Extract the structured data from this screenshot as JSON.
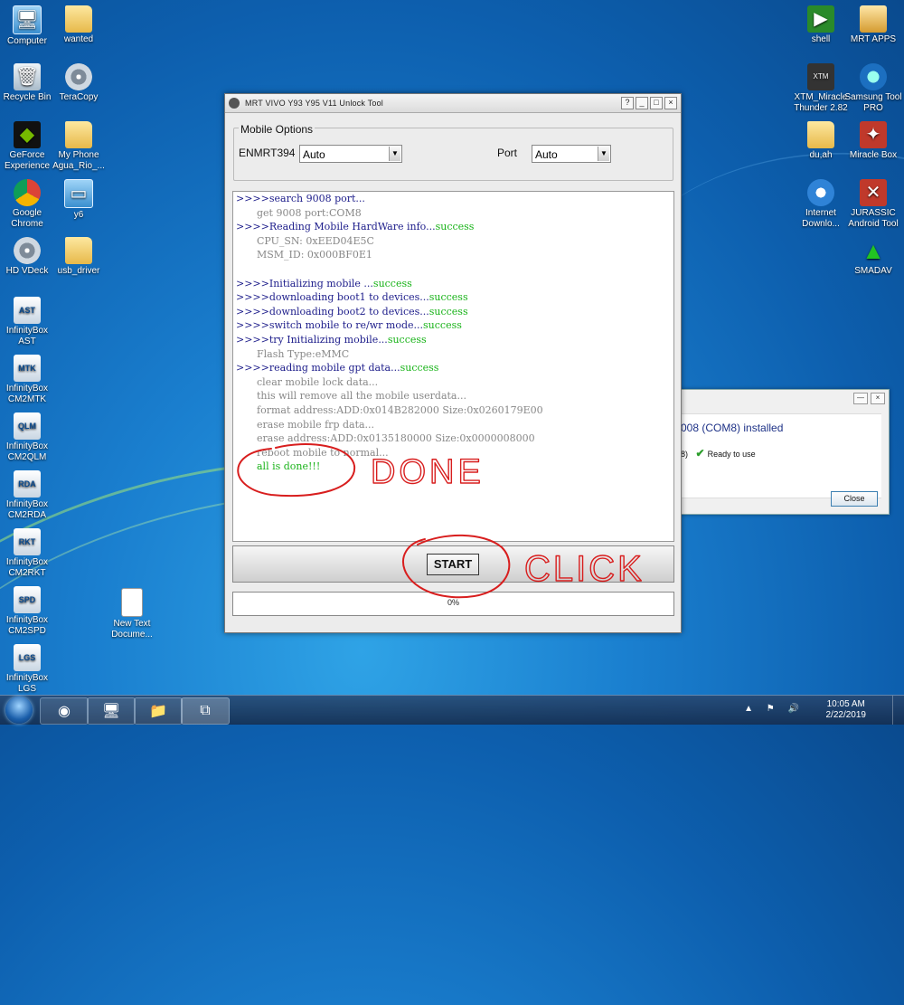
{
  "desktop": {
    "icons_left": [
      {
        "label": "Computer",
        "icon": "computer-icon"
      },
      {
        "label": "wanted",
        "icon": "folder-icon"
      },
      {
        "label": "Recycle Bin",
        "icon": "recycle-bin-icon"
      },
      {
        "label": "TeraCopy",
        "icon": "teracopy-icon"
      },
      {
        "label": "GeForce Experience",
        "icon": "geforce-icon"
      },
      {
        "label": "My Phone Agua_Rio_...",
        "icon": "folder-icon"
      },
      {
        "label": "Google Chrome",
        "icon": "chrome-icon"
      },
      {
        "label": "y6",
        "icon": "window-icon"
      },
      {
        "label": "HD VDeck",
        "icon": "disc-icon"
      },
      {
        "label": "usb_driver",
        "icon": "folder-icon"
      },
      {
        "label": "InfinityBox AST",
        "badge": "AST",
        "icon": "infinitybox-icon"
      },
      {
        "label": "InfinityBox CM2MTK",
        "badge": "MTK",
        "icon": "infinitybox-icon"
      },
      {
        "label": "InfinityBox CM2QLM",
        "badge": "QLM",
        "icon": "infinitybox-icon"
      },
      {
        "label": "InfinityBox CM2RDA",
        "badge": "RDA",
        "icon": "infinitybox-icon"
      },
      {
        "label": "InfinityBox CM2RKT",
        "badge": "RKT",
        "icon": "infinitybox-icon"
      },
      {
        "label": "InfinityBox CM2SPD",
        "badge": "SPD",
        "icon": "infinitybox-icon"
      },
      {
        "label": "InfinityBox LGS",
        "badge": "LGS",
        "icon": "infinitybox-icon"
      },
      {
        "label": "New Text Docume...",
        "icon": "text-document-icon"
      }
    ],
    "icons_right": [
      {
        "label": "shell",
        "icon": "shell-icon"
      },
      {
        "label": "MRT APPS",
        "icon": "mrt-apps-icon"
      },
      {
        "label": "XTM_Miracle Thunder 2.82",
        "icon": "xtm-icon"
      },
      {
        "label": "Samsung Tool PRO",
        "icon": "samsung-tool-icon"
      },
      {
        "label": "du,ah",
        "icon": "folder-icon"
      },
      {
        "label": "Miracle Box",
        "icon": "miracle-box-icon"
      },
      {
        "label": "Internet Downlo...",
        "icon": "internet-download-icon"
      },
      {
        "label": "JURASSIC Android Tool",
        "icon": "jurassic-icon"
      },
      {
        "label": "SMADAV",
        "icon": "smadav-icon"
      }
    ]
  },
  "window": {
    "title": "MRT VIVO Y93 Y95 V11 Unlock Tool",
    "buttons": {
      "help": "?",
      "minimize": "_",
      "maximize": "□",
      "close": "×"
    },
    "mobile_options": {
      "legend": "Mobile Options",
      "model_label": "ENMRT394",
      "model_value": "Auto",
      "port_label": "Port",
      "port_value": "Auto"
    },
    "log": [
      {
        "style": "blue",
        "text": ">>>>search 9008 port...",
        "status": ""
      },
      {
        "style": "gray",
        "text": "get 9008 port:COM8",
        "status": ""
      },
      {
        "style": "blue",
        "text": ">>>>Reading Mobile HardWare info...",
        "status": "success"
      },
      {
        "style": "gray",
        "text": "CPU_SN:  0xEED04E5C",
        "status": ""
      },
      {
        "style": "gray",
        "text": "MSM_ID:  0x000BF0E1",
        "status": ""
      },
      {
        "style": "blank",
        "text": "",
        "status": ""
      },
      {
        "style": "blue",
        "text": ">>>>Initializing mobile ...",
        "status": "success"
      },
      {
        "style": "blue",
        "text": ">>>>downloading boot1 to devices...",
        "status": "success"
      },
      {
        "style": "blue",
        "text": ">>>>downloading boot2 to devices...",
        "status": "success"
      },
      {
        "style": "blue",
        "text": ">>>>switch mobile to re/wr mode...",
        "status": "success"
      },
      {
        "style": "blue",
        "text": ">>>>try Initializing mobile...",
        "status": "success"
      },
      {
        "style": "gray",
        "text": "Flash Type:eMMC",
        "status": ""
      },
      {
        "style": "blue",
        "text": ">>>>reading mobile gpt data...",
        "status": "success"
      },
      {
        "style": "gray",
        "text": "clear mobile lock data...",
        "status": ""
      },
      {
        "style": "gray",
        "text": "this will remove all the mobile userdata...",
        "status": ""
      },
      {
        "style": "gray",
        "text": "format address:ADD:0x014B282000   Size:0x0260179E00",
        "status": ""
      },
      {
        "style": "gray",
        "text": "erase mobile frp data...",
        "status": ""
      },
      {
        "style": "gray",
        "text": "erase address:ADD:0x0135180000   Size:0x0000008000",
        "status": ""
      },
      {
        "style": "gray",
        "text": "reboot mobile to normal...",
        "status": ""
      },
      {
        "style": "done",
        "text": "all is done!!!",
        "status": ""
      }
    ],
    "start_label": "START",
    "progress": {
      "value": 0,
      "label": "0%"
    }
  },
  "annotations": {
    "done": "DONE",
    "click": "CLICK",
    "color": "#d81e1e"
  },
  "notification": {
    "heading": "008 (COM8) installed",
    "status_prefix": "8)",
    "status": "Ready to use",
    "close_label": "Close",
    "buttons": {
      "minimize": "—",
      "close": "×"
    }
  },
  "taskbar": {
    "apps": [
      {
        "name": "chrome",
        "glyph": "◉"
      },
      {
        "name": "computer",
        "glyph": "🖥"
      },
      {
        "name": "explorer",
        "glyph": "📁"
      },
      {
        "name": "unlock-tool",
        "glyph": "⧉"
      }
    ],
    "tray": "▲ ⚑ 🔊",
    "clock_time": "10:05 AM",
    "clock_date": "2/22/2019"
  }
}
